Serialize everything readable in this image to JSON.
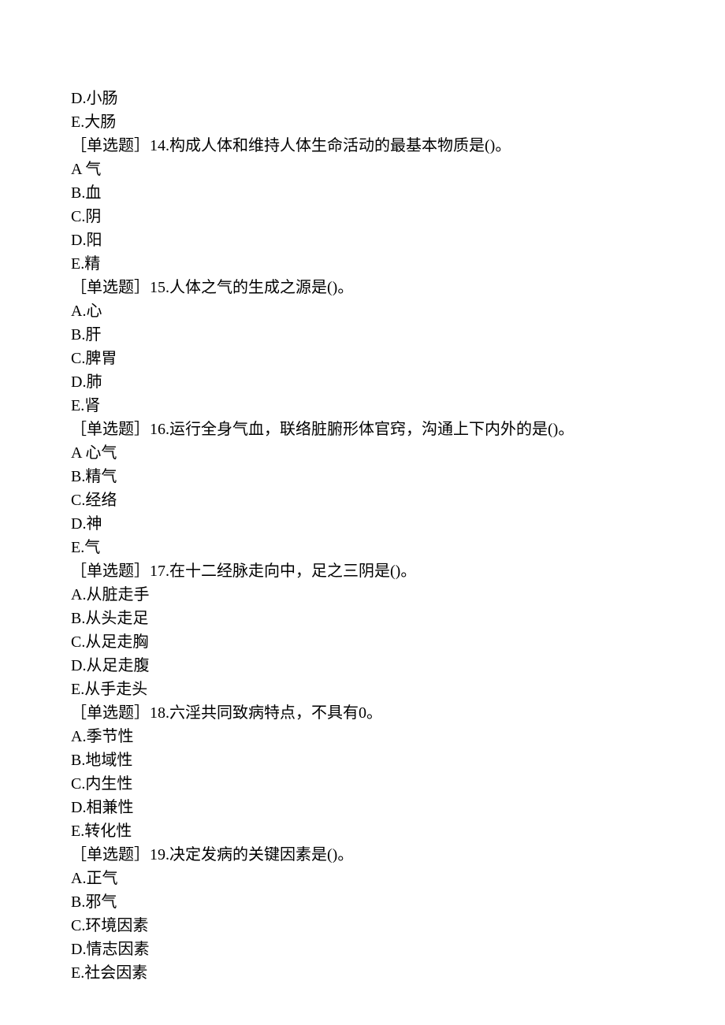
{
  "lines": [
    "D.小肠",
    "E.大肠",
    "［单选题］14.构成人体和维持人体生命活动的最基本物质是()。",
    "A 气",
    "B.血",
    "C.阴",
    "D.阳",
    "E.精",
    "［单选题］15.人体之气的生成之源是()。",
    "A.心",
    "B.肝",
    "C.脾胃",
    "D.肺",
    "E.肾",
    "［单选题］16.运行全身气血，联络脏腑形体官窍，沟通上下内外的是()。",
    "A 心气",
    "B.精气",
    "C.经络",
    "D.神",
    "E.气",
    "［单选题］17.在十二经脉走向中，足之三阴是()。",
    "A.从脏走手",
    "B.从头走足",
    "C.从足走胸",
    "D.从足走腹",
    "E.从手走头",
    "［单选题］18.六淫共同致病特点，不具有0。",
    "A.季节性",
    "B.地域性",
    "C.内生性",
    "D.相兼性",
    "E.转化性",
    "［单选题］19.决定发病的关键因素是()。",
    "A.正气",
    "B.邪气",
    "C.环境因素",
    "D.情志因素",
    "E.社会因素"
  ]
}
